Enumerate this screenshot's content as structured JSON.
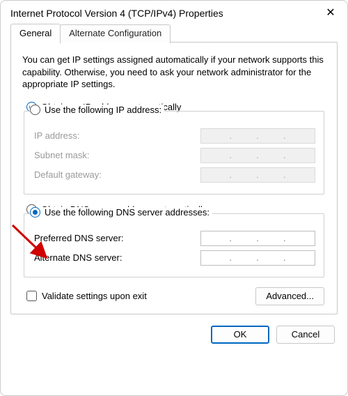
{
  "window": {
    "title": "Internet Protocol Version 4 (TCP/IPv4) Properties"
  },
  "tabs": {
    "general": "General",
    "alternate": "Alternate Configuration"
  },
  "intro": "You can get IP settings assigned automatically if your network supports this capability. Otherwise, you need to ask your network administrator for the appropriate IP settings.",
  "ip": {
    "auto": "Obtain an IP address automatically",
    "manual": "Use the following IP address:",
    "addr_label": "IP address:",
    "mask_label": "Subnet mask:",
    "gw_label": "Default gateway:"
  },
  "dns": {
    "auto": "Obtain DNS server address automatically",
    "manual": "Use the following DNS server addresses:",
    "preferred_label": "Preferred DNS server:",
    "alternate_label": "Alternate DNS server:"
  },
  "validate": "Validate settings upon exit",
  "buttons": {
    "advanced": "Advanced...",
    "ok": "OK",
    "cancel": "Cancel"
  }
}
